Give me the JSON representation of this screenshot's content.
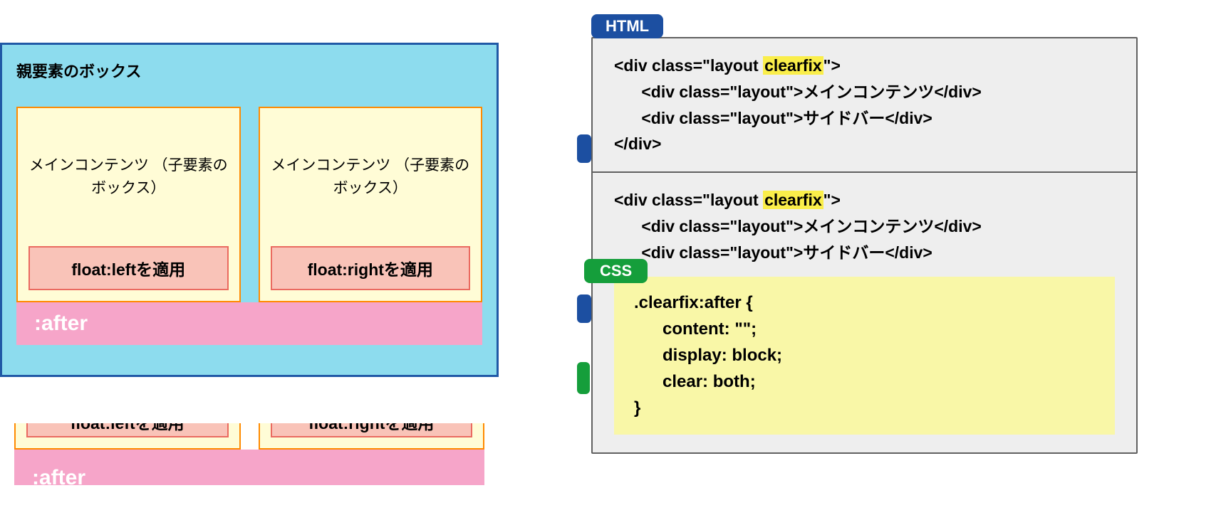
{
  "left": {
    "parent_title": "親要素のボックス",
    "child1_title": "メインコンテンツ\n（子要素のボックス）",
    "child2_title": "メインコンテンツ\n（子要素のボックス）",
    "float_left_label": "float:leftを適用",
    "float_right_label": "float:rightを適用",
    "after_label": ":after",
    "float_left_label2": "float:leftを適用",
    "float_right_label2": "float:rightを適用",
    "after_label2": ":after"
  },
  "right": {
    "html_tab": "HTML",
    "css_tab": "CSS",
    "highlight": "clearfix",
    "code1_prefix": "<div class=\"layout ",
    "code1_suffix": "\">\n      <div class=\"layout\">メインコンテンツ</div>\n      <div class=\"layout\">サイドバー</div>\n</div>",
    "code2_prefix": "<div class=\"layout ",
    "code2_suffix": "\">\n      <div class=\"layout\">メインコンテンツ</div>\n      <div class=\"layout\">サイドバー</div>",
    "css_code": ".clearfix:after {\n      content: \"\";\n      display: block;\n      clear: both;\n}"
  }
}
